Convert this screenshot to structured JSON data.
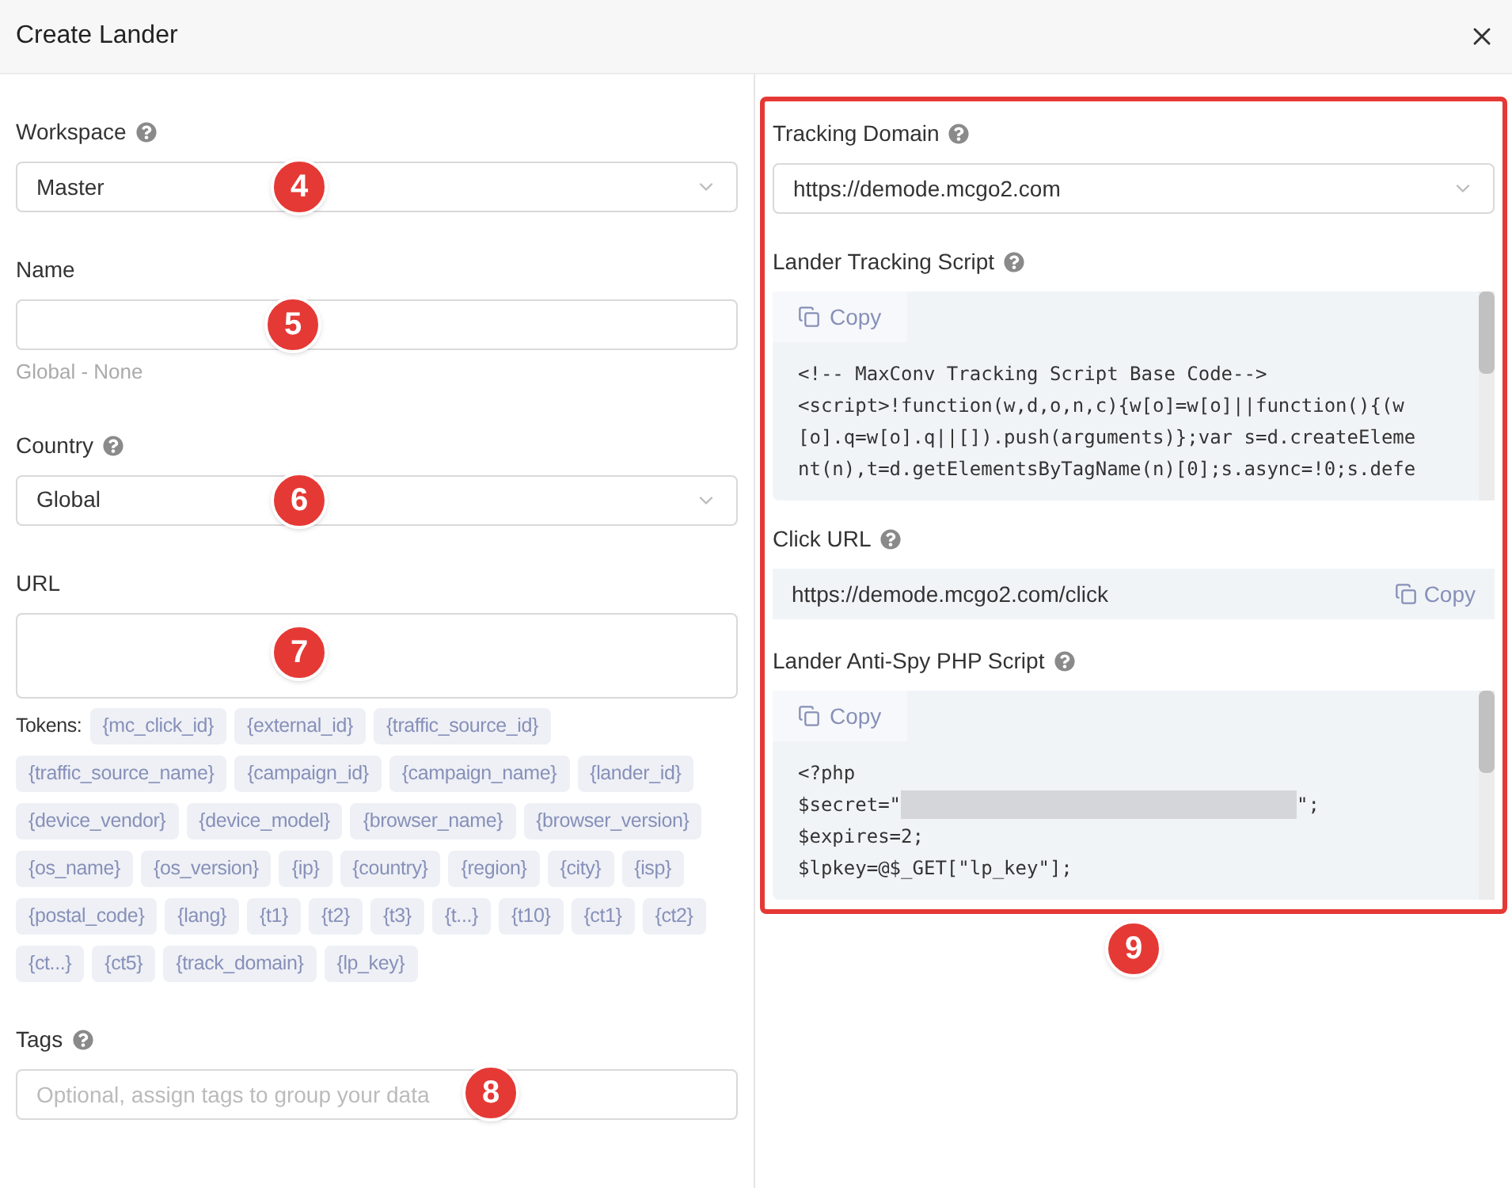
{
  "dialog": {
    "title": "Create Lander"
  },
  "left": {
    "workspace": {
      "label": "Workspace",
      "value": "Master",
      "callout": "4"
    },
    "name": {
      "label": "Name",
      "hint": "Global - None",
      "callout": "5"
    },
    "country": {
      "label": "Country",
      "value": "Global",
      "callout": "6"
    },
    "url": {
      "label": "URL",
      "callout": "7"
    },
    "tokens": {
      "label": "Tokens:",
      "items": [
        "{mc_click_id}",
        "{external_id}",
        "{traffic_source_id}",
        "{traffic_source_name}",
        "{campaign_id}",
        "{campaign_name}",
        "{lander_id}",
        "{device_vendor}",
        "{device_model}",
        "{browser_name}",
        "{browser_version}",
        "{os_name}",
        "{os_version}",
        "{ip}",
        "{country}",
        "{region}",
        "{city}",
        "{isp}",
        "{postal_code}",
        "{lang}",
        "{t1}",
        "{t2}",
        "{t3}",
        "{t...}",
        "{t10}",
        "{ct1}",
        "{ct2}",
        "{ct...}",
        "{ct5}",
        "{track_domain}",
        "{lp_key}"
      ]
    },
    "tags": {
      "label": "Tags",
      "placeholder": "Optional, assign tags to group your data",
      "callout": "8"
    }
  },
  "right": {
    "callout": "9",
    "tracking_domain": {
      "label": "Tracking Domain",
      "value": "https://demode.mcgo2.com"
    },
    "tracking_script": {
      "label": "Lander Tracking Script",
      "copy": "Copy",
      "lines": [
        {
          "kind": "text",
          "text": "<!-- MaxConv Tracking Script Base Code-->"
        },
        {
          "kind": "text",
          "text": "<script>!function(w,d,o,n,c){w[o]=w[o]||function(){(w"
        },
        {
          "kind": "text",
          "text": "[o].q=w[o].q||[]).push(arguments)};var s=d.createEleme"
        },
        {
          "kind": "text",
          "text": "nt(n),t=d.getElementsByTagName(n)[0];s.async=!0;s.defe"
        }
      ]
    },
    "click_url": {
      "label": "Click URL",
      "value": "https://demode.mcgo2.com/click",
      "copy": "Copy"
    },
    "php_script": {
      "label": "Lander Anti-Spy PHP Script",
      "copy": "Copy",
      "lines": [
        {
          "kind": "text",
          "text": "<?php"
        },
        {
          "kind": "redacted",
          "before": "$secret=\"",
          "after": "\";"
        },
        {
          "kind": "text",
          "text": "$expires=2;"
        },
        {
          "kind": "text",
          "text": "$lpkey=@$_GET[\"lp_key\"];"
        }
      ]
    }
  }
}
